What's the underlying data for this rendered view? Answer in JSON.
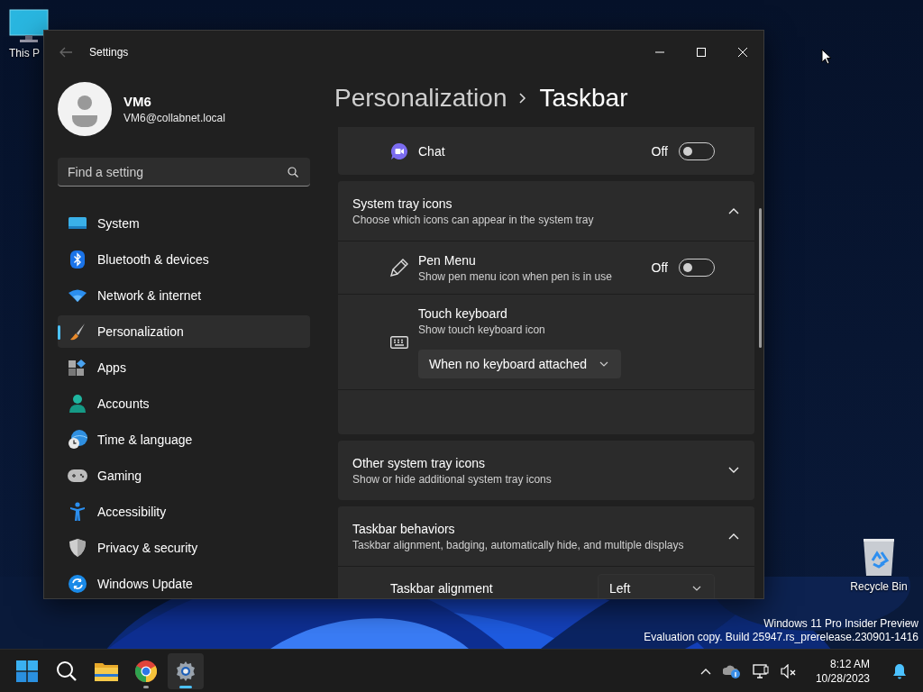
{
  "desktop_icons": [
    {
      "label": "This P",
      "kind": "pc"
    },
    {
      "label": "Recycle Bin",
      "kind": "recycle"
    }
  ],
  "window": {
    "title": "Settings"
  },
  "account": {
    "name": "VM6",
    "email": "VM6@collabnet.local"
  },
  "search": {
    "placeholder": "Find a setting"
  },
  "nav": [
    {
      "label": "System",
      "selected": false
    },
    {
      "label": "Bluetooth & devices",
      "selected": false
    },
    {
      "label": "Network & internet",
      "selected": false
    },
    {
      "label": "Personalization",
      "selected": true
    },
    {
      "label": "Apps",
      "selected": false
    },
    {
      "label": "Accounts",
      "selected": false
    },
    {
      "label": "Time & language",
      "selected": false
    },
    {
      "label": "Gaming",
      "selected": false
    },
    {
      "label": "Accessibility",
      "selected": false
    },
    {
      "label": "Privacy & security",
      "selected": false
    },
    {
      "label": "Windows Update",
      "selected": false
    }
  ],
  "breadcrumb": [
    "Personalization",
    "Taskbar"
  ],
  "sections": [
    {
      "kind": "toggle",
      "label": "Chat",
      "state_text": "Off",
      "on": false
    },
    {
      "kind": "group",
      "title": "System tray icons",
      "subtitle": "Choose which icons can appear in the system tray",
      "expanded": true,
      "items": [
        {
          "kind": "toggle",
          "label": "Pen Menu",
          "description": "Show pen menu icon when pen is in use",
          "state_text": "Off",
          "on": false
        },
        {
          "kind": "dropdown",
          "label": "Touch keyboard",
          "description": "Show touch keyboard icon",
          "value": "When no keyboard attached"
        }
      ]
    },
    {
      "kind": "group",
      "title": "Other system tray icons",
      "subtitle": "Show or hide additional system tray icons",
      "expanded": false
    },
    {
      "kind": "group",
      "title": "Taskbar behaviors",
      "subtitle": "Taskbar alignment, badging, automatically hide, and multiple displays",
      "expanded": true,
      "items": [
        {
          "kind": "select",
          "label": "Taskbar alignment",
          "value": "Left"
        }
      ]
    }
  ],
  "build_info": [
    "Windows 11 Pro Insider Preview",
    "Evaluation copy. Build 25947.rs_prerelease.230901-1416"
  ],
  "taskbar": {
    "apps": [
      {
        "running": false,
        "selected": false
      },
      {
        "running": false,
        "selected": false
      },
      {
        "running": false,
        "selected": false
      },
      {
        "running": true,
        "selected": false
      },
      {
        "running": true,
        "selected": true
      }
    ],
    "time": "8:12 AM",
    "date": "10/28/2023"
  }
}
